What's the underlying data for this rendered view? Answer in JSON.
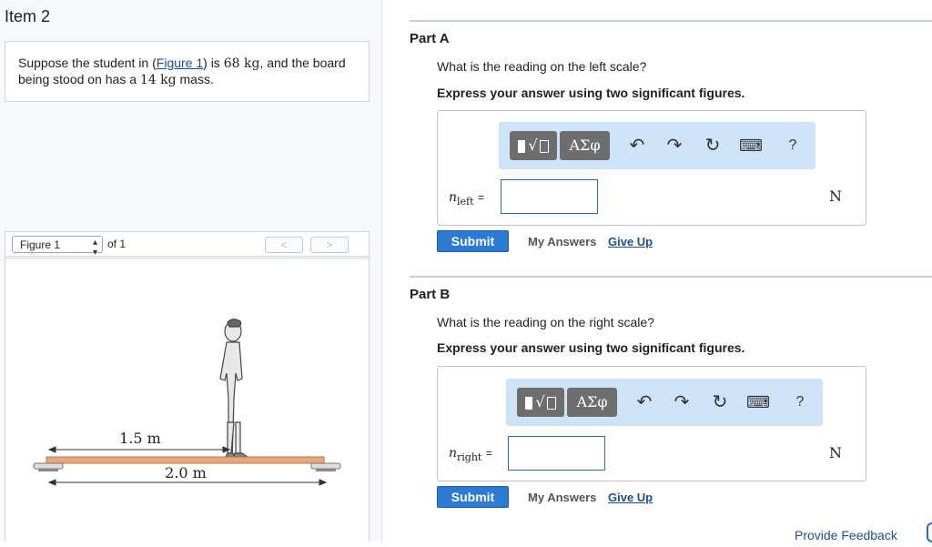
{
  "item": {
    "title": "Item 2"
  },
  "problem": {
    "text_before": "Suppose the student in (",
    "figure_link": "Figure 1",
    "text_mid": ") is ",
    "mass_student": "68 kg",
    "text_mid2": ", and the board being stood on has a ",
    "mass_board": "14 kg",
    "text_after": " mass."
  },
  "figure_nav": {
    "select_value": "Figure 1",
    "of_text": "of 1",
    "prev": "<",
    "next": ">"
  },
  "figure": {
    "label_top": "1.5 m",
    "label_bottom": "2.0 m"
  },
  "toolbar": {
    "template_label": "√",
    "greek_label": "ΑΣφ",
    "undo": "↶",
    "redo": "↷",
    "reset": "↻",
    "keyboard": "⌨",
    "help": "?"
  },
  "partA": {
    "title": "Part A",
    "question": "What is the reading on the left scale?",
    "instruction": "Express your answer using two significant figures.",
    "var_main": "n",
    "var_sub": "left",
    "equals": "=",
    "value": "",
    "unit": "N",
    "submit": "Submit",
    "my_answers": "My Answers",
    "give_up": "Give Up"
  },
  "partB": {
    "title": "Part B",
    "question": "What is the reading on the right scale?",
    "instruction": "Express your answer using two significant figures.",
    "var_main": "n",
    "var_sub": "right",
    "equals": "=",
    "value": "",
    "unit": "N",
    "submit": "Submit",
    "my_answers": "My Answers",
    "give_up": "Give Up"
  },
  "footer": {
    "feedback": "Provide Feedback"
  }
}
